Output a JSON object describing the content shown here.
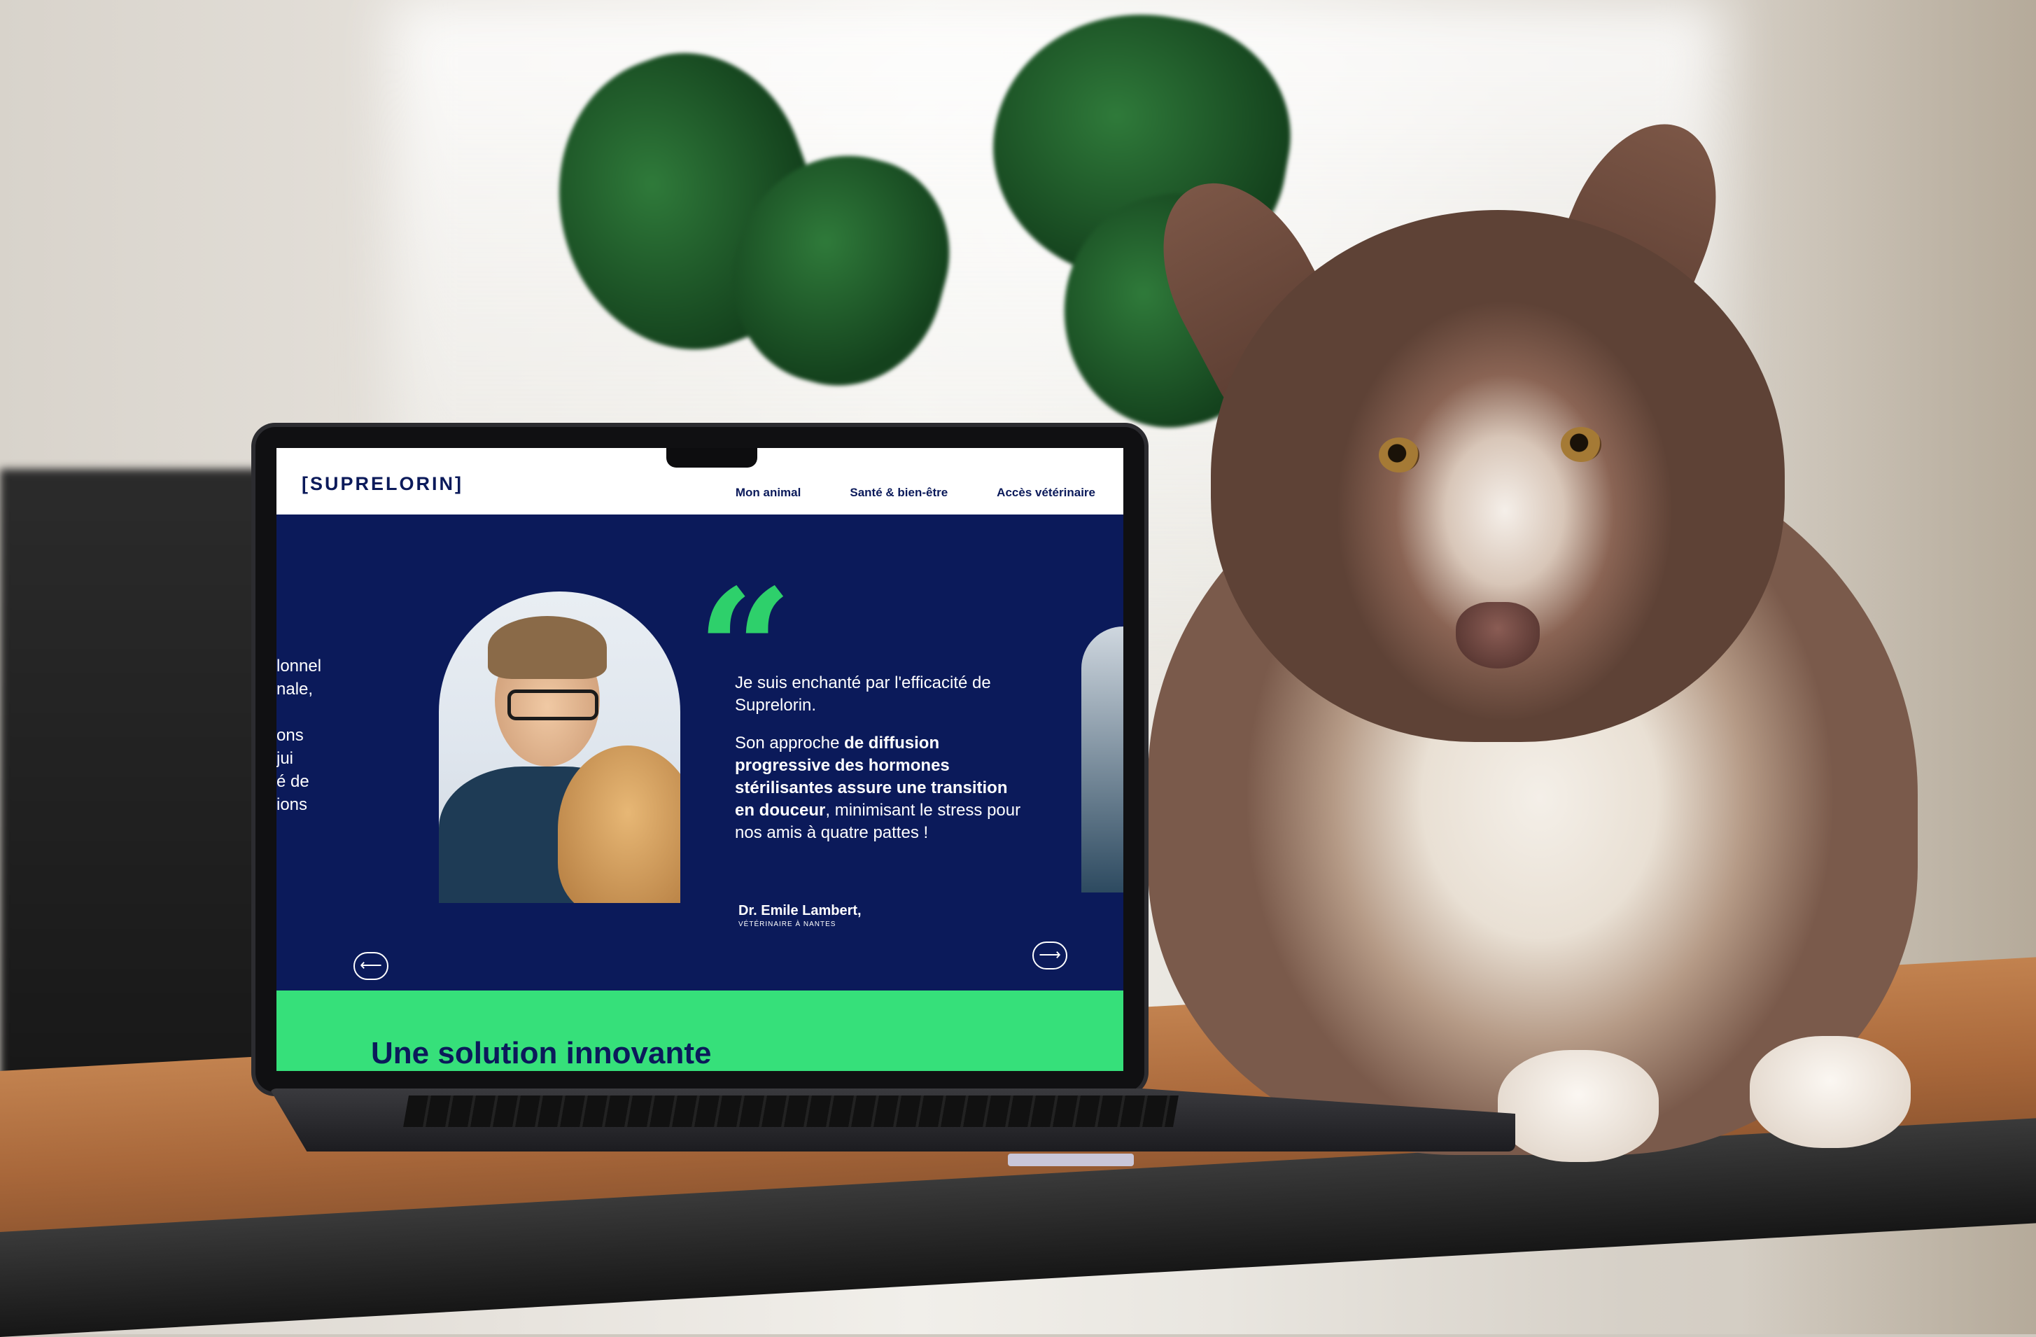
{
  "site": {
    "logo": "[SUPRELORIN]",
    "nav": [
      "Mon animal",
      "Santé & bien-être",
      "Accès vétérinaire"
    ]
  },
  "hero": {
    "left_peek": [
      "lonnel",
      "nale,",
      "",
      "ons",
      "jui",
      "é de",
      "ions"
    ],
    "quote_mark": "“",
    "quote_intro": "Je suis enchanté par l'efficacité de Suprelorin.",
    "quote_part1": "Son approche ",
    "quote_bold1": "de diffusion progressive des hormones stérilisantes assure une transition en douceur",
    "quote_part2": ", minimisant le stress pour nos amis à quatre pattes !",
    "author_name": "Dr. Emile Lambert,",
    "author_role": "VÉTÉRINAIRE À NANTES",
    "prev_arrow": "⟵",
    "next_arrow": "⟶"
  },
  "band": {
    "title": "Une solution innovante"
  },
  "colors": {
    "navy": "#0b1a5a",
    "green": "#36e07a",
    "quote_green": "#2ed06b"
  },
  "icons": {
    "prev": "arrow-left-icon",
    "next": "arrow-right-icon"
  }
}
